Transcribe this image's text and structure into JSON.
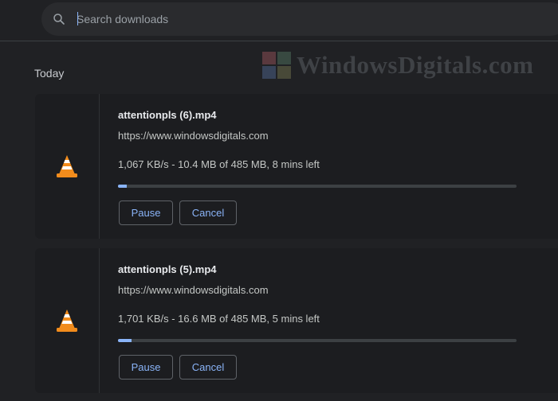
{
  "search": {
    "placeholder": "Search downloads"
  },
  "watermark": {
    "text": "WindowsDigitals.com"
  },
  "section": {
    "label": "Today"
  },
  "downloads": [
    {
      "filename": "attentionpls (6).mp4",
      "url": "https://www.windowsdigitals.com",
      "status": "1,067 KB/s - 10.4 MB of 485 MB, 8 mins left",
      "progress_fraction": 0.021,
      "pause_label": "Pause",
      "cancel_label": "Cancel",
      "icon": "vlc-cone-icon"
    },
    {
      "filename": "attentionpls (5).mp4",
      "url": "https://www.windowsdigitals.com",
      "status": "1,701 KB/s - 16.6 MB of 485 MB, 5 mins left",
      "progress_fraction": 0.034,
      "pause_label": "Pause",
      "cancel_label": "Cancel",
      "icon": "vlc-cone-icon"
    }
  ],
  "colors": {
    "background": "#202124",
    "card": "#1c1d20",
    "accent": "#8ab4f8",
    "track": "#3c4043",
    "vlc_orange": "#f28c1c"
  }
}
